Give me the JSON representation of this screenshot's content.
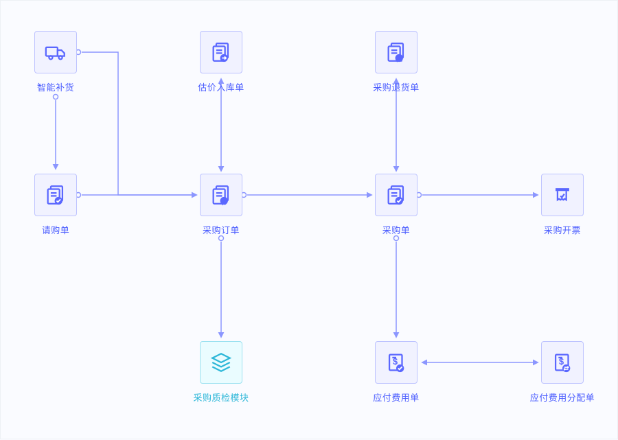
{
  "nodes": {
    "smart_restock": {
      "label": "智能补货",
      "icon": "truck",
      "variant": "default"
    },
    "estimate_inbound": {
      "label": "估价入库单",
      "icon": "doc-arrow",
      "variant": "default"
    },
    "return_order": {
      "label": "采购退货单",
      "icon": "doc-return",
      "variant": "default"
    },
    "requisition": {
      "label": "请购单",
      "icon": "doc-check",
      "variant": "default"
    },
    "purchase_order": {
      "label": "采购订单",
      "icon": "doc-order",
      "variant": "default"
    },
    "purchase_bill": {
      "label": "采购单",
      "icon": "doc-check",
      "variant": "default"
    },
    "invoice": {
      "label": "采购开票",
      "icon": "invoice",
      "variant": "default"
    },
    "qc_module": {
      "label": "采购质检模块",
      "icon": "layers",
      "variant": "cyan"
    },
    "payable": {
      "label": "应付费用单",
      "icon": "doc-money-check",
      "variant": "default"
    },
    "payable_alloc": {
      "label": "应付费用分配单",
      "icon": "doc-money-swap",
      "variant": "default"
    }
  },
  "colors": {
    "primary": "#5a67ff",
    "primary_light": "#8b96ff",
    "box_bg": "#f1f2ff",
    "cyan": "#2db7d8"
  }
}
